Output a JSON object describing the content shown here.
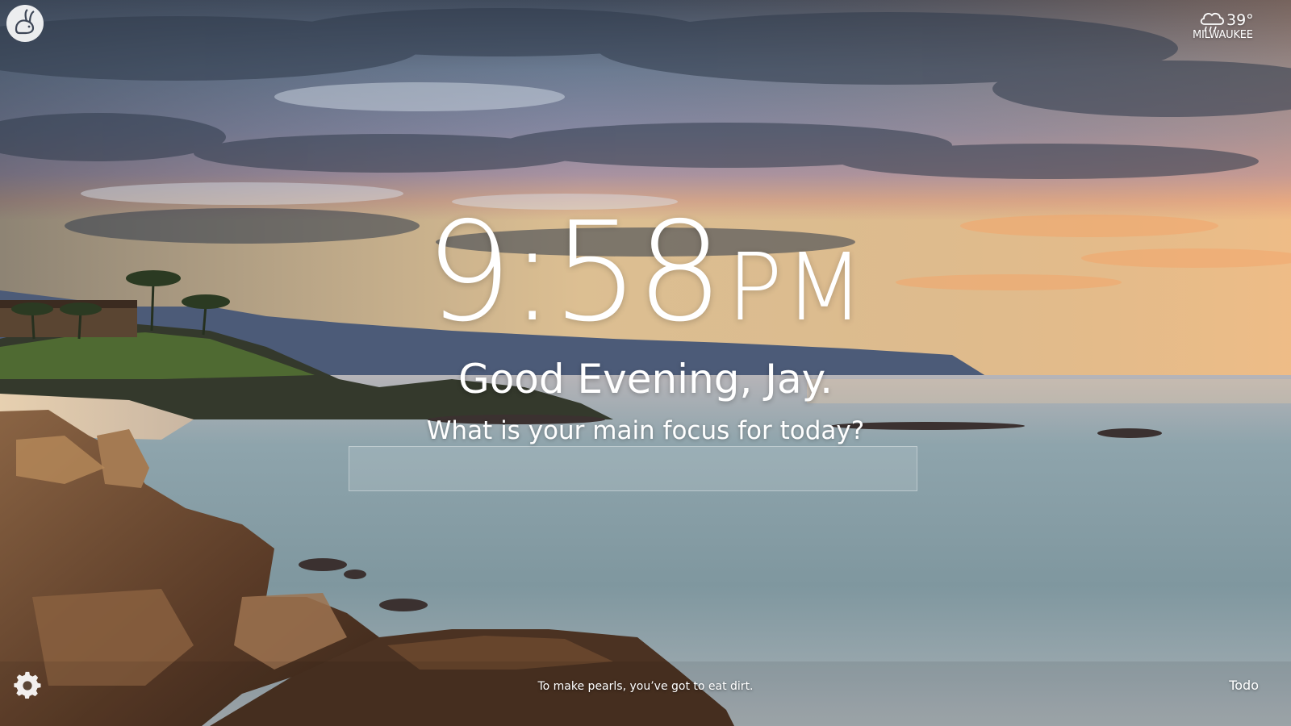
{
  "app": {
    "logo_icon": "rabbit-icon"
  },
  "weather": {
    "icon": "rain-cloud-icon",
    "temperature": "39°",
    "city": "MILWAUKEE"
  },
  "clock": {
    "time": "9:58",
    "ampm": "PM"
  },
  "greeting": {
    "text": "Good Evening, Jay."
  },
  "focus": {
    "question": "What is your main focus for today?",
    "input_value": "",
    "input_placeholder": ""
  },
  "footer": {
    "settings_icon": "gear-icon",
    "quote": "To make pearls, you’ve got to eat dirt.",
    "todo_label": "Todo"
  },
  "colors": {
    "text": "#ffffff",
    "sky_orange": "#f2a35c",
    "sea": "#7f97a2",
    "rock": "#6b4b33"
  }
}
